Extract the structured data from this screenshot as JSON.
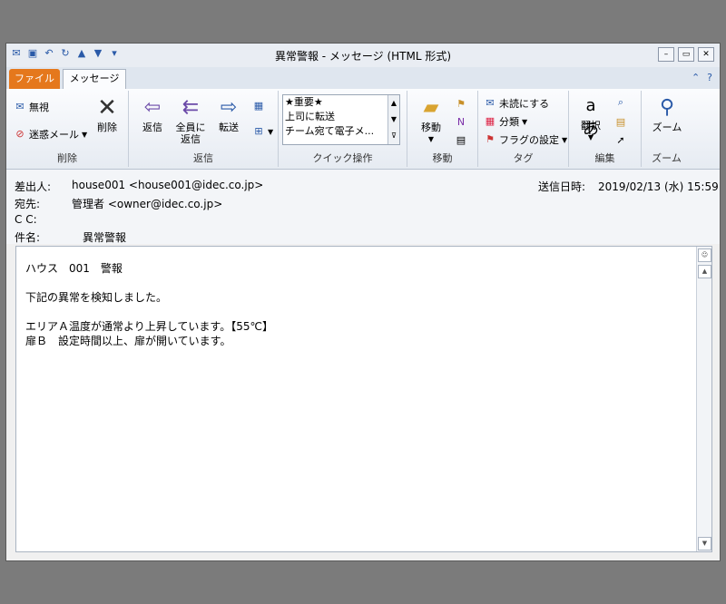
{
  "window": {
    "title": "異常警報 - メッセージ (HTML 形式)"
  },
  "tabs": {
    "file": "ファイル",
    "message": "メッセージ"
  },
  "ribbon": {
    "delete_group": {
      "label": "削除",
      "ignore": "無視",
      "junk": "迷惑メール",
      "delete": "削除"
    },
    "reply_group": {
      "label": "返信",
      "reply": "返信",
      "reply_all_1": "全員に",
      "reply_all_2": "返信",
      "forward": "転送"
    },
    "quick_group": {
      "label": "クイック操作",
      "items": [
        "★重要★",
        "上司に転送",
        "チーム宛て電子メ..."
      ]
    },
    "move_group": {
      "label": "移動",
      "move": "移動"
    },
    "tag_group": {
      "label": "タグ",
      "unread": "未読にする",
      "categorize": "分類",
      "flag": "フラグの設定"
    },
    "edit_group": {
      "label": "編集",
      "translate": "翻訳"
    },
    "zoom_group": {
      "label": "ズーム",
      "zoom": "ズーム"
    }
  },
  "header": {
    "from_label": "差出人:",
    "from_value": "house001 <house001@idec.co.jp>",
    "sent_label": "送信日時:",
    "sent_value": "2019/02/13 (水) 15:59",
    "to_label": "宛先:",
    "to_value": "管理者 <owner@idec.co.jp>",
    "cc_label": "C C:",
    "subject_label": "件名:",
    "subject_value": "異常警報"
  },
  "body": {
    "lines": [
      "ハウス　001　警報",
      "",
      "下記の異常を検知しました。",
      "",
      "エリアＡ温度が通常より上昇しています。【55℃】",
      "扉Ｂ　設定時間以上、扉が開いています。"
    ]
  },
  "icons": {
    "accent": "#2a5aa8",
    "file_tab": "#e5781c"
  }
}
